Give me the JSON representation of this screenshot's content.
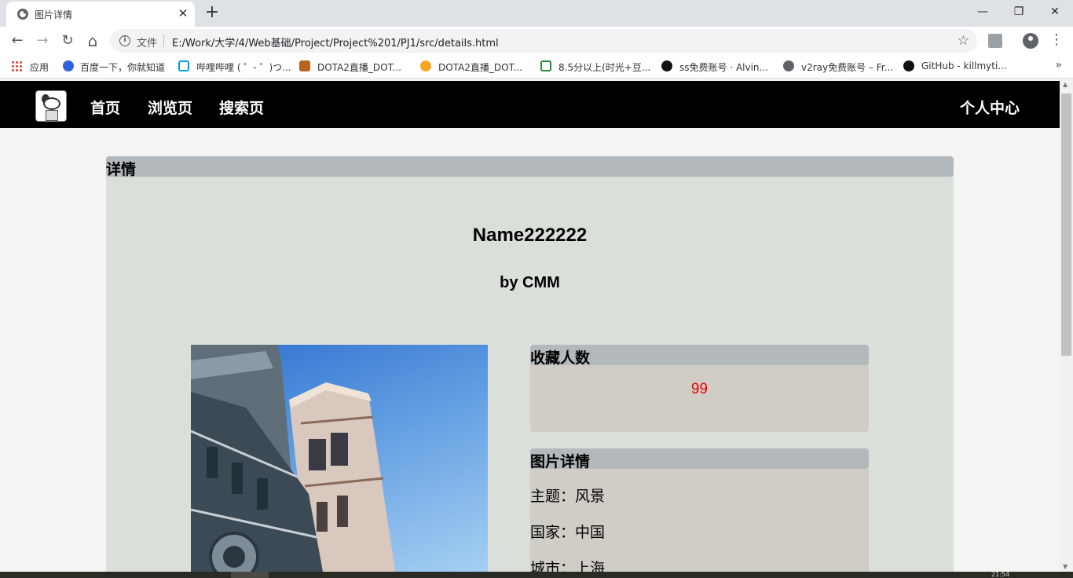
{
  "browser": {
    "tab_title": "图片详情",
    "tab_close": "✕",
    "new_tab": "+",
    "window": {
      "minimize": "—",
      "restore": "❐",
      "close": "✕"
    },
    "nav": {
      "back": "←",
      "forward": "→",
      "reload": "↻",
      "home": "⌂"
    },
    "info_icon": "i",
    "file_label": "文件",
    "url": "E:/Work/大学/4/Web基础/Project/Project%201/PJ1/src/details.html",
    "star": "☆",
    "menu": "⋮",
    "bookmarks": [
      {
        "label": "应用",
        "icon": "apps-grid-icon"
      },
      {
        "label": "百度一下，你就知道",
        "icon": "baidu-paw-icon"
      },
      {
        "label": "哔哩哔哩 ( ゜- ゜)つ...",
        "icon": "bilibili-icon"
      },
      {
        "label": "DOTA2直播_DOT...",
        "icon": "dota-icon"
      },
      {
        "label": "DOTA2直播_DOT...",
        "icon": "douyu-icon"
      },
      {
        "label": "8.5分以上(时光+豆...",
        "icon": "douban-icon"
      },
      {
        "label": "ss免费账号 · Alvin...",
        "icon": "github-icon"
      },
      {
        "label": "v2ray免费账号 – Fr...",
        "icon": "globe-icon"
      },
      {
        "label": "GitHub - killmyti...",
        "icon": "github-icon"
      }
    ],
    "bookmarks_more": "»",
    "colors": {
      "tabstrip": "#dee1e6",
      "omnibox": "#f1f3f4"
    }
  },
  "site": {
    "nav": {
      "home": "首页",
      "browse": "浏览页",
      "search": "搜索页",
      "profile": "个人中心"
    },
    "colors": {
      "navbar": "#000000",
      "panel": "#dadfd9",
      "header": "#b2b8bc",
      "box": "#d0cdc6",
      "count": "#e00000"
    }
  },
  "details": {
    "header": "详情",
    "title": "Name222222",
    "author": "by CMM",
    "favorites": {
      "header": "收藏人数",
      "count": "99"
    },
    "info": {
      "header": "图片详情",
      "lines": [
        "主题：风景",
        "国家：中国",
        "城市：上海"
      ]
    }
  },
  "taskbar": {
    "clock": "21:54"
  }
}
